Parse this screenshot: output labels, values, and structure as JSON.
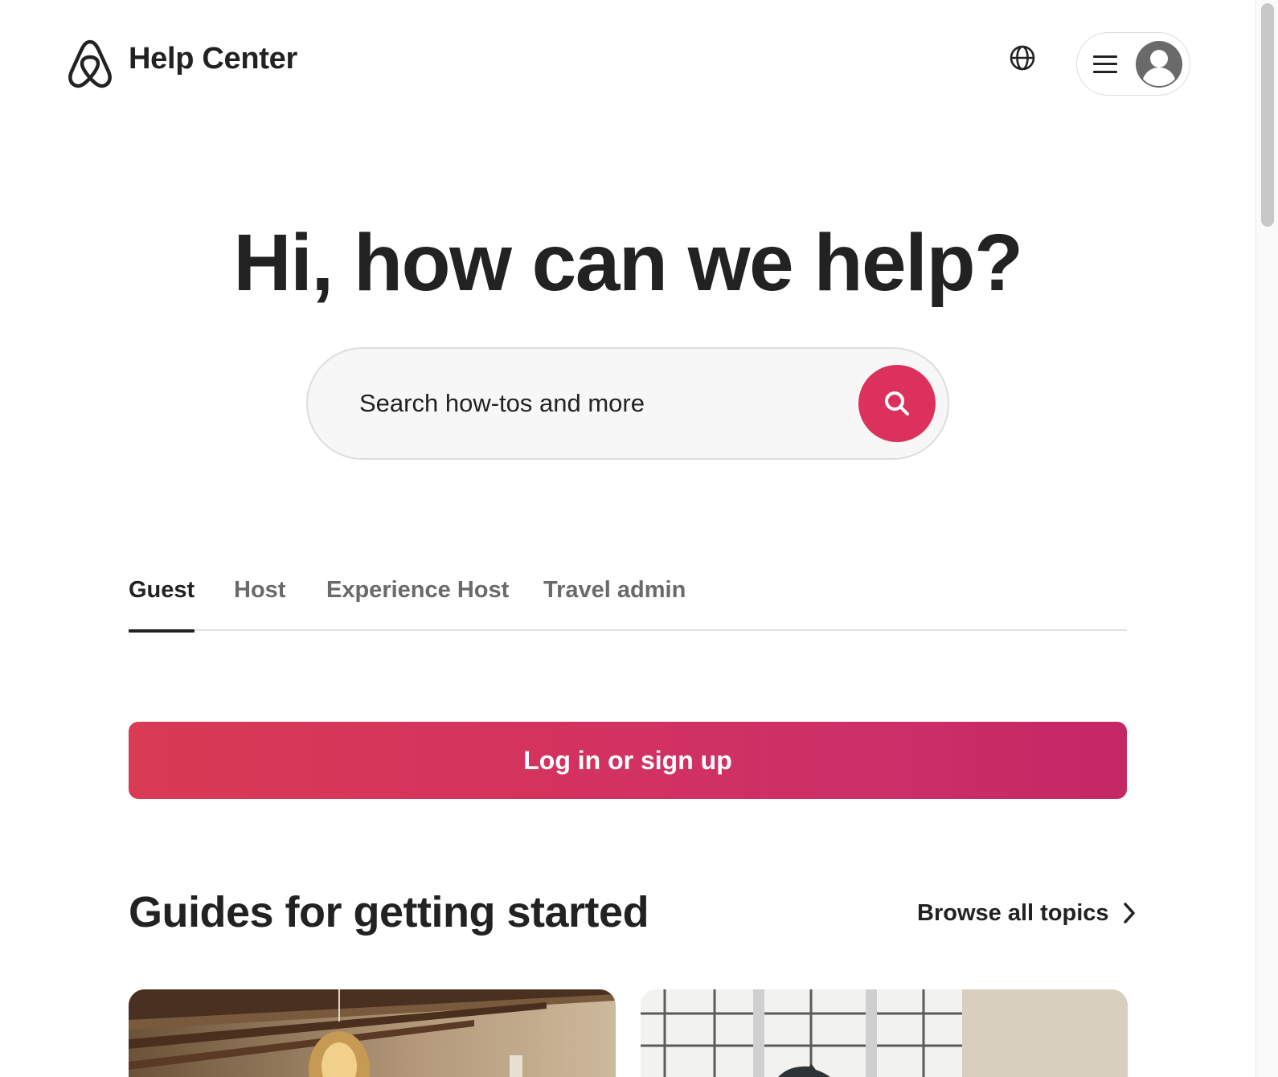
{
  "header": {
    "logo_icon": "airbnb-logo-icon",
    "title": "Help Center",
    "language_icon": "globe-icon",
    "menu_icon": "hamburger-menu-icon",
    "avatar_icon": "user-avatar-icon"
  },
  "hero": {
    "title": "Hi, how can we help?"
  },
  "search": {
    "placeholder": "Search how-tos and more",
    "button_icon": "search-icon"
  },
  "tabs": [
    {
      "label": "Guest",
      "active": true
    },
    {
      "label": "Host",
      "active": false
    },
    {
      "label": "Experience Host",
      "active": false
    },
    {
      "label": "Travel admin",
      "active": false
    }
  ],
  "login": {
    "label": "Log in or sign up"
  },
  "guides": {
    "title": "Guides for getting started",
    "browse_label": "Browse all topics",
    "browse_icon": "chevron-right-icon"
  },
  "colors": {
    "brand": "#dc315d",
    "text": "#222222",
    "muted": "#6a6a6a",
    "border": "#dddddd"
  }
}
